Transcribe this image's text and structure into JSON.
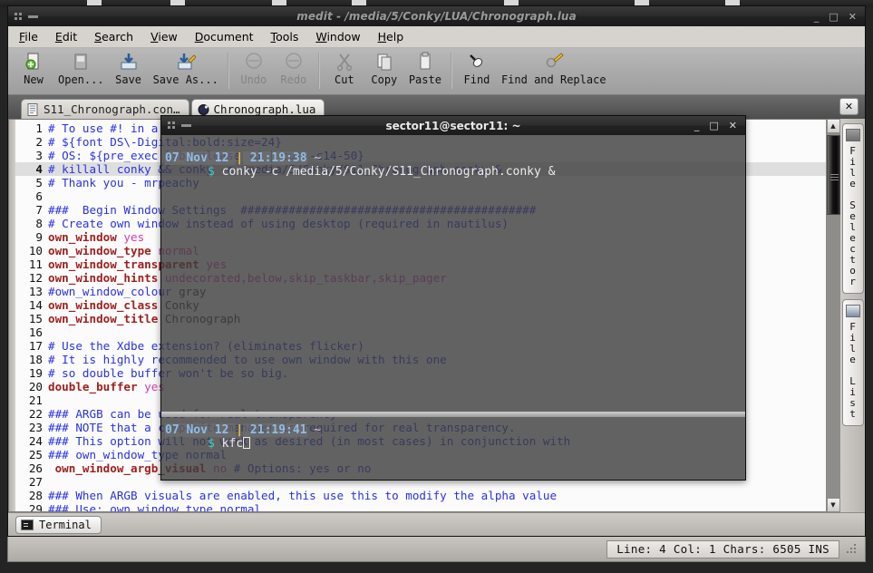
{
  "window": {
    "title": "medit - /media/5/Conky/LUA/Chronograph.lua",
    "minimize": "_",
    "maximize": "□",
    "close": "✕",
    "menu_dots_icon": "grip-dots-icon",
    "menu_dash_icon": "dash-icon"
  },
  "menubar": {
    "items": [
      {
        "label": "File",
        "accel": "F"
      },
      {
        "label": "Edit",
        "accel": "E"
      },
      {
        "label": "Search",
        "accel": "S"
      },
      {
        "label": "View",
        "accel": "V"
      },
      {
        "label": "Document",
        "accel": "D"
      },
      {
        "label": "Tools",
        "accel": "T"
      },
      {
        "label": "Window",
        "accel": "W"
      },
      {
        "label": "Help",
        "accel": "H"
      }
    ]
  },
  "toolbar": {
    "items": [
      {
        "label": "New",
        "icon": "new-document-icon",
        "disabled": false
      },
      {
        "label": "Open...",
        "icon": "open-folder-icon",
        "disabled": false
      },
      {
        "label": "Save",
        "icon": "save-disk-icon",
        "disabled": false
      },
      {
        "label": "Save As...",
        "icon": "save-as-icon",
        "disabled": false
      },
      {
        "sep": true
      },
      {
        "label": "Undo",
        "icon": "undo-arrow-icon",
        "disabled": true
      },
      {
        "label": "Redo",
        "icon": "redo-arrow-icon",
        "disabled": true
      },
      {
        "sep": true
      },
      {
        "label": "Cut",
        "icon": "scissors-icon",
        "disabled": false
      },
      {
        "label": "Copy",
        "icon": "copy-pages-icon",
        "disabled": false
      },
      {
        "label": "Paste",
        "icon": "clipboard-icon",
        "disabled": false
      },
      {
        "sep": true
      },
      {
        "label": "Find",
        "icon": "flashlight-icon",
        "disabled": false
      },
      {
        "label": "Find and Replace",
        "icon": "find-replace-pencil-icon",
        "disabled": false
      }
    ]
  },
  "tabs": {
    "items": [
      {
        "label": "S11_Chronograph.con…",
        "icon": "text-file-icon",
        "active": false
      },
      {
        "label": "Chronograph.lua",
        "icon": "lua-moon-icon",
        "active": true
      }
    ],
    "close_label": "✕"
  },
  "editor": {
    "lines": [
      {
        "n": "1",
        "cur": false,
        "spans": [
          {
            "c": "comment",
            "t": "# To use #! in a script add: -e"
          }
        ]
      },
      {
        "n": "2",
        "cur": false,
        "spans": [
          {
            "c": "comment",
            "t": "# ${font DS\\-Digital:bold:size=24}"
          }
        ]
      },
      {
        "n": "3",
        "cur": false,
        "spans": [
          {
            "c": "comment",
            "t": "# OS: ${pre_exec lsb_release -d | cut -c14-50}"
          }
        ]
      },
      {
        "n": "4",
        "cur": true,
        "spans": [
          {
            "c": "comment",
            "t": "# killall conky && conky -c /media/5/Conky/S11_Chronograph.conky &"
          }
        ]
      },
      {
        "n": "5",
        "cur": false,
        "spans": [
          {
            "c": "comment",
            "t": "# Thank you - mrpeachy"
          }
        ]
      },
      {
        "n": "6",
        "cur": false,
        "spans": [
          {
            "c": "plain",
            "t": ""
          }
        ]
      },
      {
        "n": "7",
        "cur": false,
        "spans": [
          {
            "c": "comment",
            "t": "###  Begin Window Settings  ###########################################"
          }
        ]
      },
      {
        "n": "8",
        "cur": false,
        "spans": [
          {
            "c": "comment",
            "t": "# Create own window instead of using desktop (required in nautilus)"
          }
        ]
      },
      {
        "n": "9",
        "cur": false,
        "spans": [
          {
            "c": "key",
            "t": "own_window"
          },
          {
            "c": "plain",
            "t": " "
          },
          {
            "c": "val",
            "t": "yes"
          }
        ]
      },
      {
        "n": "10",
        "cur": false,
        "spans": [
          {
            "c": "key",
            "t": "own_window_type"
          },
          {
            "c": "plain",
            "t": " "
          },
          {
            "c": "val",
            "t": "normal"
          }
        ]
      },
      {
        "n": "11",
        "cur": false,
        "spans": [
          {
            "c": "key",
            "t": "own_window_transparent"
          },
          {
            "c": "plain",
            "t": " "
          },
          {
            "c": "val",
            "t": "yes"
          }
        ]
      },
      {
        "n": "12",
        "cur": false,
        "spans": [
          {
            "c": "key",
            "t": "own_window_hints"
          },
          {
            "c": "plain",
            "t": " "
          },
          {
            "c": "val",
            "t": "undecorated,below,skip_taskbar,skip_pager"
          }
        ]
      },
      {
        "n": "13",
        "cur": false,
        "spans": [
          {
            "c": "comment",
            "t": "#own_window_colour"
          },
          {
            "c": "str",
            "t": " gray"
          }
        ]
      },
      {
        "n": "14",
        "cur": false,
        "spans": [
          {
            "c": "key",
            "t": "own_window_class"
          },
          {
            "c": "str",
            "t": " Conky"
          }
        ]
      },
      {
        "n": "15",
        "cur": false,
        "spans": [
          {
            "c": "key",
            "t": "own_window_title"
          },
          {
            "c": "str",
            "t": " Chronograph"
          }
        ]
      },
      {
        "n": "16",
        "cur": false,
        "spans": [
          {
            "c": "plain",
            "t": ""
          }
        ]
      },
      {
        "n": "17",
        "cur": false,
        "spans": [
          {
            "c": "comment",
            "t": "# Use the Xdbe extension? (eliminates flicker)"
          }
        ]
      },
      {
        "n": "18",
        "cur": false,
        "spans": [
          {
            "c": "comment",
            "t": "# It is highly recommended to use own window with this one"
          }
        ]
      },
      {
        "n": "19",
        "cur": false,
        "spans": [
          {
            "c": "comment",
            "t": "# so double buffer won't be so big."
          }
        ]
      },
      {
        "n": "20",
        "cur": false,
        "spans": [
          {
            "c": "key",
            "t": "double_buffer"
          },
          {
            "c": "plain",
            "t": " "
          },
          {
            "c": "val",
            "t": "yes"
          }
        ]
      },
      {
        "n": "21",
        "cur": false,
        "spans": [
          {
            "c": "plain",
            "t": ""
          }
        ]
      },
      {
        "n": "22",
        "cur": false,
        "spans": [
          {
            "c": "comment",
            "t": "### ARGB can be used for real transparency"
          }
        ]
      },
      {
        "n": "23",
        "cur": false,
        "spans": [
          {
            "c": "comment",
            "t": "### NOTE that a composite manager is required for real transparency."
          }
        ]
      },
      {
        "n": "24",
        "cur": false,
        "spans": [
          {
            "c": "comment",
            "t": "### This option will not work as desired (in most cases) in conjunction with"
          }
        ]
      },
      {
        "n": "25",
        "cur": false,
        "spans": [
          {
            "c": "comment",
            "t": "### own_window_type normal"
          }
        ]
      },
      {
        "n": "26",
        "cur": false,
        "spans": [
          {
            "c": "plain",
            "t": " "
          },
          {
            "c": "key",
            "t": "own_window_argb_visual"
          },
          {
            "c": "plain",
            "t": " "
          },
          {
            "c": "val",
            "t": "no"
          },
          {
            "c": "comment",
            "t": " # Options: yes or no"
          }
        ]
      },
      {
        "n": "27",
        "cur": false,
        "spans": [
          {
            "c": "plain",
            "t": ""
          }
        ]
      },
      {
        "n": "28",
        "cur": false,
        "spans": [
          {
            "c": "comment",
            "t": "### When ARGB visuals are enabled, this use this to modify the alpha value"
          }
        ]
      },
      {
        "n": "29",
        "cur": false,
        "spans": [
          {
            "c": "comment",
            "t": "### Use: own_window_type normal"
          }
        ]
      }
    ],
    "scrollbar": {
      "up_arrow": "▲",
      "down_arrow": "▼"
    }
  },
  "sidepanel": {
    "tabs": [
      {
        "label": "File Selector",
        "icon": "file-selector-icon"
      },
      {
        "label": "File List",
        "icon": "file-list-icon"
      }
    ]
  },
  "taskbar": {
    "items": [
      {
        "label": "Terminal",
        "icon": "terminal-icon"
      }
    ]
  },
  "statusbar": {
    "text": "Line: 4 Col: 1  Chars: 6505  INS"
  },
  "terminal": {
    "title": "sector11@sector11: ~",
    "minimize": "_",
    "maximize": "□",
    "close": "✕",
    "lines": [
      {
        "type": "text",
        "text": ""
      },
      {
        "type": "prompt",
        "date": "07 Nov 12",
        "bar": "|",
        "time": "21:19:38",
        "tilde": " ~",
        "dollar": "$",
        "command": "conky -c /media/5/Conky/S11_Chronograph.conky &",
        "cursor": false
      },
      {
        "type": "text",
        "text": ""
      },
      {
        "type": "text",
        "text": ""
      },
      {
        "type": "text",
        "text": ""
      },
      {
        "type": "text",
        "text": ""
      },
      {
        "type": "text",
        "text": ""
      },
      {
        "type": "text",
        "text": ""
      },
      {
        "type": "text",
        "text": ""
      },
      {
        "type": "text",
        "text": ""
      },
      {
        "type": "text",
        "text": ""
      },
      {
        "type": "text",
        "text": ""
      },
      {
        "type": "text",
        "text": ""
      },
      {
        "type": "text",
        "text": ""
      },
      {
        "type": "text",
        "text": ""
      },
      {
        "type": "text",
        "text": ""
      },
      {
        "type": "text",
        "text": ""
      },
      {
        "type": "text",
        "text": ""
      },
      {
        "type": "text",
        "text": ""
      },
      {
        "type": "text",
        "text": ""
      },
      {
        "type": "prompt",
        "date": "07 Nov 12",
        "bar": "|",
        "time": "21:19:41",
        "tilde": " ~",
        "dollar": "$",
        "command": "kfc",
        "cursor": true
      }
    ]
  },
  "colors": {
    "comment": "#2a32e0",
    "keyword": "#9e2020",
    "value": "#d03fb0",
    "terminal_bg": "#585858",
    "prompt_date": "#8fbce8",
    "prompt_bar": "#f2c14a",
    "prompt_dollar": "#3fd0c9",
    "titlebar": "#242424",
    "chrome": "#d6d3ce"
  }
}
